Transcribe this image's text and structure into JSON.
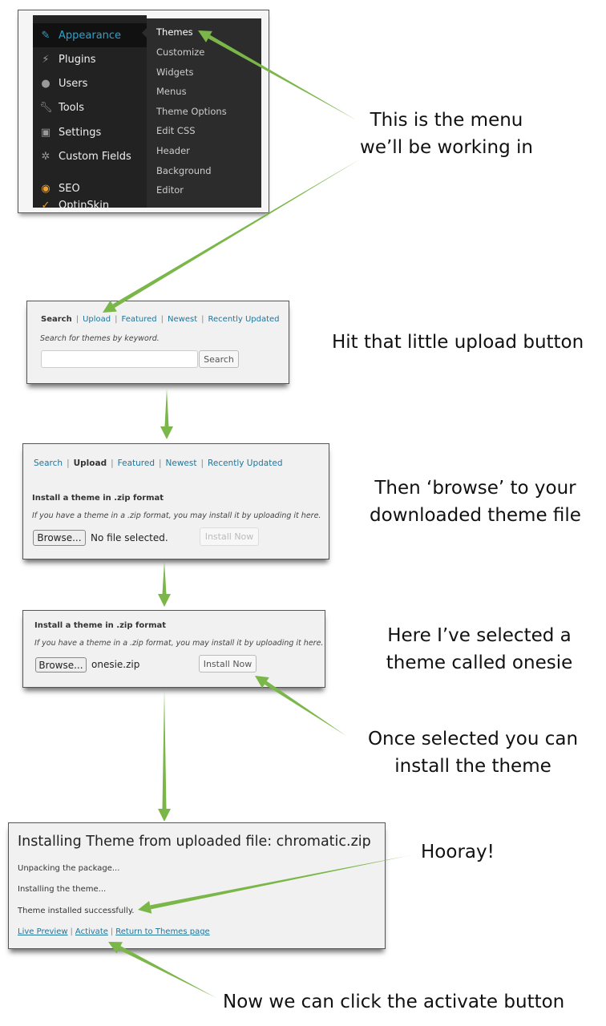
{
  "menu_panel": {
    "left_menu": [
      {
        "label": "Appearance",
        "icon": "paintbrush-icon",
        "active": true
      },
      {
        "label": "Plugins",
        "icon": "plug-icon"
      },
      {
        "label": "Users",
        "icon": "user-icon"
      },
      {
        "label": "Tools",
        "icon": "wrench-icon"
      },
      {
        "label": "Settings",
        "icon": "settings-icon"
      },
      {
        "label": "Custom Fields",
        "icon": "gear-icon"
      },
      {
        "label": "SEO",
        "icon": "seo-icon"
      },
      {
        "label": "OptinSkin",
        "icon": "optinskin-icon"
      }
    ],
    "submenu": [
      "Themes",
      "Customize",
      "Widgets",
      "Menus",
      "Theme Options",
      "Edit CSS",
      "Header",
      "Background",
      "Editor"
    ],
    "accent": "#2ea2cc"
  },
  "search_panel": {
    "tabs": [
      "Search",
      "Upload",
      "Featured",
      "Newest",
      "Recently Updated"
    ],
    "hint": "Search for themes by keyword.",
    "search_value": "",
    "search_button": "Search"
  },
  "upload_panel": {
    "tabs": [
      "Search",
      "Upload",
      "Featured",
      "Newest",
      "Recently Updated"
    ],
    "heading": "Install a theme in .zip format",
    "description": "If you have a theme in a .zip format, you may install it by uploading it here.",
    "browse_button": "Browse...",
    "file_status": "No file selected.",
    "install_button": "Install Now"
  },
  "selected_panel": {
    "heading": "Install a theme in .zip format",
    "description": "If you have a theme in a .zip format, you may install it by uploading it here.",
    "browse_button": "Browse...",
    "file_status": "onesie.zip",
    "install_button": "Install Now"
  },
  "result_panel": {
    "title": "Installing Theme from uploaded file: chromatic.zip",
    "lines": [
      "Unpacking the package...",
      "Installing the theme...",
      "Theme installed successfully."
    ],
    "links": [
      "Live Preview",
      "Activate",
      "Return to Themes page"
    ]
  },
  "notes": {
    "menu": [
      "This is the menu",
      "we’ll be working in"
    ],
    "upload": "Hit that little upload button",
    "browse": [
      "Then ‘browse’ to your",
      "downloaded theme file"
    ],
    "selected": [
      "Here I’ve selected a",
      "theme called onesie"
    ],
    "install": [
      "Once selected you can",
      "install the theme"
    ],
    "hooray": "Hooray!",
    "activate": "Now we can click the activate button"
  },
  "colors": {
    "arrow": "#7ab648",
    "link": "#21759b"
  }
}
